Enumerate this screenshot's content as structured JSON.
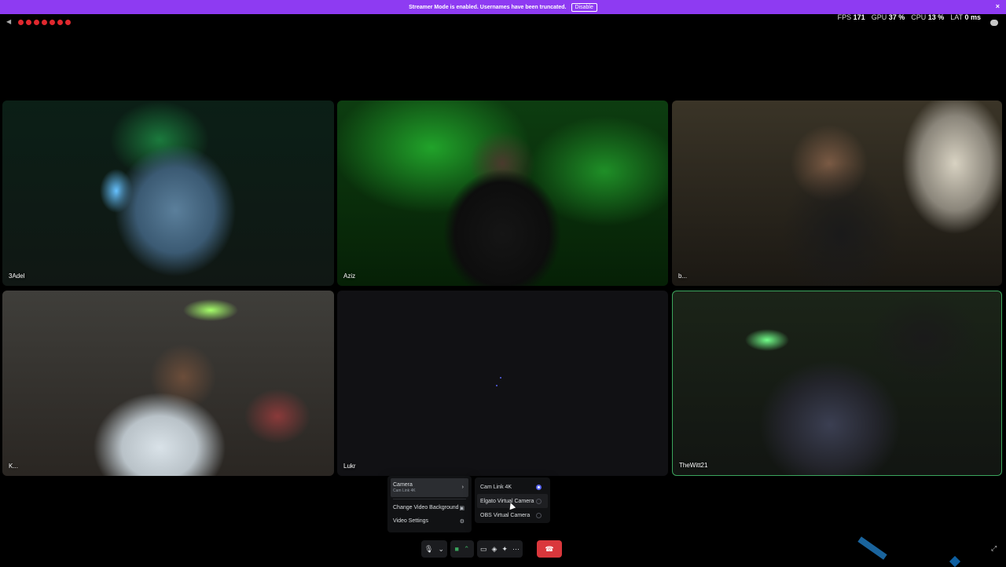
{
  "banner": {
    "message": "Streamer Mode is enabled. Usernames have been truncated.",
    "disable_label": "Disable",
    "close": "×",
    "color": "#8e3bf2"
  },
  "stats": {
    "fps_label": "FPS",
    "fps_value": "171",
    "gpu_label": "GPU",
    "gpu_value": "37 %",
    "cpu_label": "CPU",
    "cpu_value": "13 %",
    "lat_label": "LAT",
    "lat_value": "0 ms"
  },
  "participants": [
    {
      "name": "3Adel"
    },
    {
      "name": "Aziz"
    },
    {
      "name": "b..."
    },
    {
      "name": "K..."
    },
    {
      "name": "Lukr"
    },
    {
      "name": "TheWitt21"
    }
  ],
  "camera_menu": {
    "camera_label": "Camera",
    "camera_sub": "Cam Link 4K",
    "change_bg": "Change Video Background",
    "video_settings": "Video Settings"
  },
  "camera_options": [
    {
      "label": "Cam Link 4K",
      "selected": true
    },
    {
      "label": "Elgato Virtual Camera",
      "selected": false
    },
    {
      "label": "OBS Virtual Camera",
      "selected": false
    }
  ],
  "colors": {
    "accent": "#5865f2",
    "speaking": "#3ba55d",
    "hangup": "#da373c"
  },
  "icons": [
    "volume-icon",
    "mic-icon",
    "camera-icon",
    "screenshare-icon",
    "activity-icon",
    "soundboard-icon",
    "more-icon",
    "hangup-icon",
    "fullscreen-icon",
    "chat-icon"
  ]
}
